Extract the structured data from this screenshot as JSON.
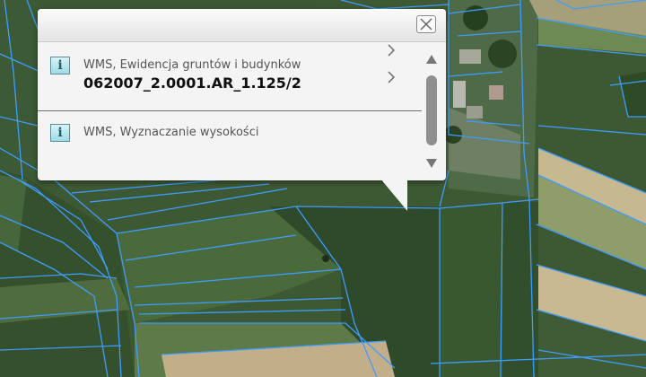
{
  "popup": {
    "items": [
      {
        "icon": "info-icon",
        "icon_glyph": "i",
        "title": "WMS, Ewidencja gruntów i budynków",
        "value": "062007_2.0001.AR_1.125/2"
      },
      {
        "icon": "info-icon",
        "icon_glyph": "i",
        "title": "WMS, Wyznaczanie wysokości",
        "value": ""
      }
    ],
    "close_icon": "close-icon",
    "chevron_icon": "chevron-right-icon"
  },
  "map": {
    "parcel_line_color": "#3f9cff"
  }
}
